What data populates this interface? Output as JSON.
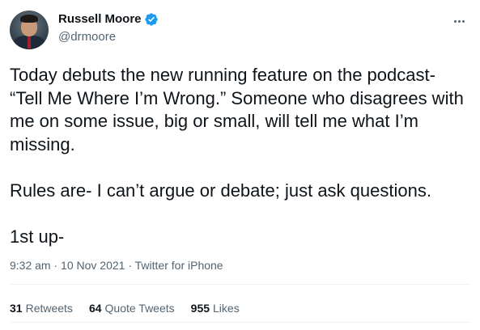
{
  "author": {
    "display_name": "Russell Moore",
    "handle": "@drmoore",
    "verified": true
  },
  "tweet": {
    "paragraphs": [
      "Today debuts the new running feature on the podcast- “Tell Me Where I’m Wrong.” Someone who disagrees with me on some issue, big or small, will tell me what I’m missing.",
      "Rules are- I can’t argue or debate; just ask questions.",
      "1st up-"
    ]
  },
  "meta": {
    "time": "9:32 am",
    "separator": " · ",
    "date": "10 Nov 2021",
    "source": "Twitter for iPhone"
  },
  "stats": {
    "retweets": {
      "count": "31",
      "label": "Retweets"
    },
    "quote_tweets": {
      "count": "64",
      "label": "Quote Tweets"
    },
    "likes": {
      "count": "955",
      "label": "Likes"
    }
  },
  "colors": {
    "verified_badge": "#1d9bf0",
    "secondary_text": "#536471",
    "primary_text": "#0f1419"
  },
  "icons": {
    "verified": "verified-badge-icon",
    "more": "more-options-icon"
  }
}
